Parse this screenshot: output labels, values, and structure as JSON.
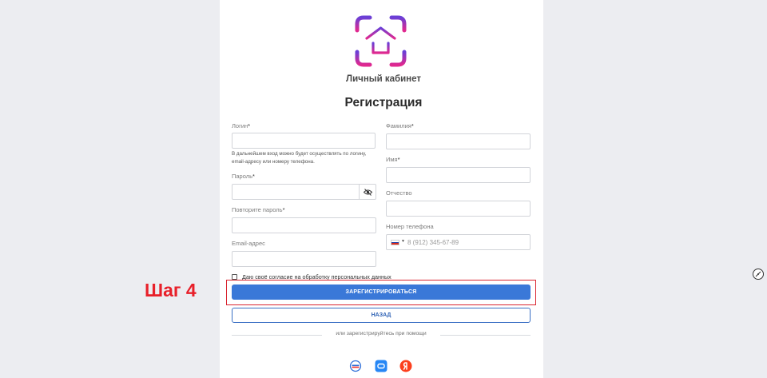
{
  "header": {
    "brand": "Личный кабинет",
    "title": "Регистрация"
  },
  "form": {
    "login": {
      "label": "Логин",
      "required_mark": "*",
      "value": "",
      "placeholder": ""
    },
    "login_hint": "В дальнейшем вход можно будет осуществлять по логину, email-адресу или номеру телефона.",
    "password": {
      "label": "Пароль",
      "required_mark": "*",
      "value": ""
    },
    "password_repeat": {
      "label": "Повторите пароль",
      "required_mark": "*",
      "value": ""
    },
    "email": {
      "label": "Email-адрес",
      "value": ""
    },
    "surname": {
      "label": "Фамилия",
      "required_mark": "*",
      "value": ""
    },
    "name": {
      "label": "Имя",
      "required_mark": "*",
      "value": ""
    },
    "patronymic": {
      "label": "Отчество",
      "value": ""
    },
    "phone": {
      "label": "Номер телефона",
      "placeholder": "8 (912) 345-67-89",
      "value": "",
      "country_icon": "flag-ru-icon",
      "flag_colors": [
        "#ffffff",
        "#1c3fa8",
        "#d52b1e"
      ]
    },
    "consent": {
      "label": "Даю своё согласие на обработку персональных данных",
      "checked": false
    }
  },
  "actions": {
    "register_label": "ЗАРЕГИСТРИРОВАТЬСЯ",
    "back_label": "НАЗАД"
  },
  "social": {
    "separator_text": "или зарегистрируйтесь при помощи",
    "providers": [
      {
        "name": "gosuslugi",
        "icon": "gosuslugi-icon"
      },
      {
        "name": "vk",
        "icon": "vk-icon"
      },
      {
        "name": "yandex",
        "icon": "yandex-icon"
      }
    ]
  },
  "annotation": {
    "step_label": "Шаг 4",
    "color": "#e8202a"
  },
  "colors": {
    "primary": "#3a78d8",
    "logo_gradient": [
      "#6a3fd6",
      "#e0288f"
    ],
    "background": "#ecedf1"
  }
}
